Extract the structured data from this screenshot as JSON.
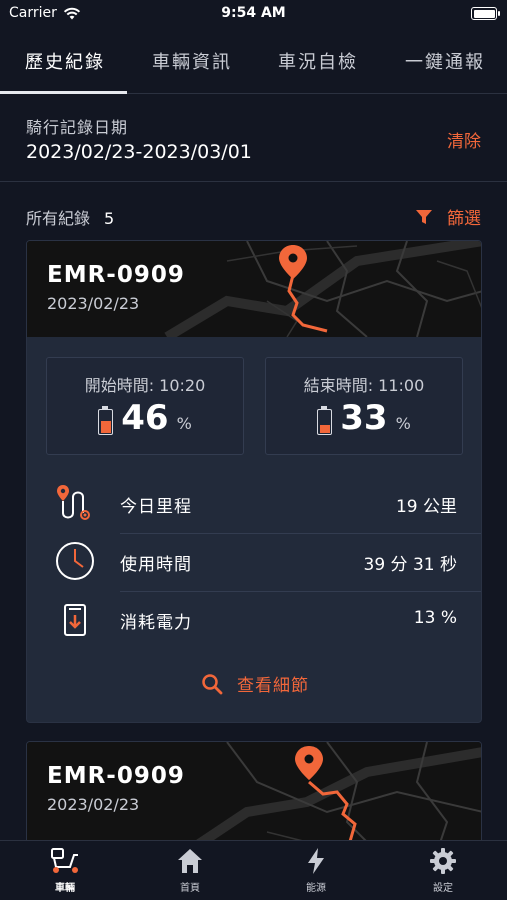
{
  "status_bar": {
    "carrier": "Carrier",
    "time": "9:54 AM"
  },
  "tabs": [
    {
      "label": "歷史紀錄",
      "active": true
    },
    {
      "label": "車輛資訊",
      "active": false
    },
    {
      "label": "車況自檢",
      "active": false
    },
    {
      "label": "一鍵通報",
      "active": false
    }
  ],
  "date_filter": {
    "label": "騎行記錄日期",
    "range": "2023/02/23-2023/03/01",
    "clear_label": "清除"
  },
  "records": {
    "all_label": "所有紀錄",
    "count": "5",
    "filter_label": "篩選"
  },
  "cards": [
    {
      "plate": "EMR-0909",
      "date": "2023/02/23",
      "start_label": "開始時間: 10:20",
      "start_battery": "46",
      "start_battery_fraction": 0.46,
      "end_label": "結束時間: 11:00",
      "end_battery": "33",
      "end_battery_fraction": 0.33,
      "battery_unit": "%",
      "mileage_label": "今日里程",
      "mileage_value": "19 公里",
      "usage_label": "使用時間",
      "usage_value": "39 分 31 秒",
      "power_label": "消耗電力",
      "power_value": "13 %",
      "detail_label": "查看細節"
    },
    {
      "plate": "EMR-0909",
      "date": "2023/02/23"
    }
  ],
  "bottom_nav": [
    {
      "label": "車輛",
      "icon": "scooter-icon",
      "active": true
    },
    {
      "label": "首頁",
      "icon": "home-icon",
      "active": false
    },
    {
      "label": "能源",
      "icon": "lightning-icon",
      "active": false
    },
    {
      "label": "設定",
      "icon": "gear-icon",
      "active": false
    }
  ],
  "colors": {
    "accent": "#f2673a",
    "background": "#121622",
    "card": "#222a3a"
  }
}
